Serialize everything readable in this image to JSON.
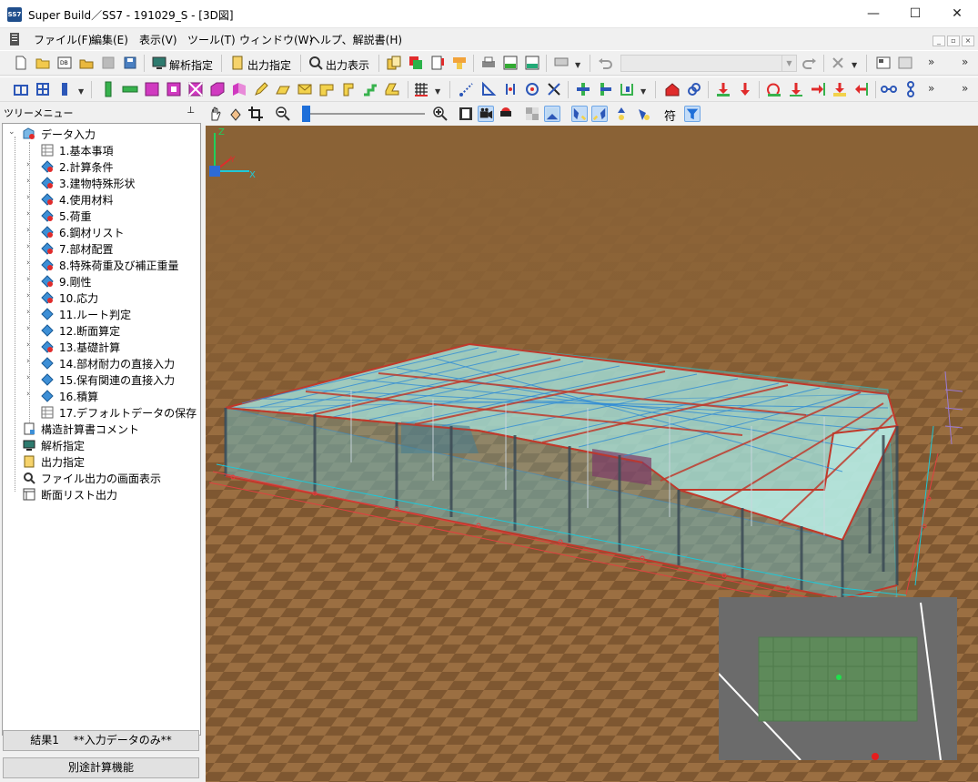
{
  "window": {
    "icon_text": "SS7",
    "title": "Super Build／SS7 - 191029_S - [3D図]",
    "minimize": "—",
    "maximize": "☐",
    "close": "✕"
  },
  "menu": {
    "items": [
      "ファイル(F)",
      "編集(E)",
      "表示(V)",
      "ツール(T)",
      "ウィンドウ(W)",
      "ヘルプ、解説書(H)"
    ]
  },
  "toolbar1": {
    "analysis_label": "解析指定",
    "output_label": "出力指定",
    "display_label": "出力表示",
    "combo_value": ""
  },
  "tree": {
    "header": "ツリーメニュー",
    "pin": "📌",
    "root": "データ入力",
    "items": [
      "1.基本事項",
      "2.計算条件",
      "3.建物特殊形状",
      "4.使用材料",
      "5.荷重",
      "6.鋼材リスト",
      "7.部材配置",
      "8.特殊荷重及び補正重量",
      "9.剛性",
      "10.応力",
      "11.ルート判定",
      "12.断面算定",
      "13.基礎計算",
      "14.部材耐力の直接入力",
      "15.保有関連の直接入力",
      "16.積算",
      "17.デフォルトデータの保存"
    ],
    "top_items": [
      "構造計算書コメント",
      "解析指定",
      "出力指定",
      "ファイル出力の画面表示",
      "断面リスト出力"
    ]
  },
  "status": {
    "result_label": "結果1　 **入力データのみ**",
    "separate_calc": "別途計算機能"
  },
  "view_toolbar": {
    "kanji_button": "符"
  },
  "axes": {
    "z": "Z",
    "y": "Y",
    "x": "X"
  },
  "colors": {
    "ground": "#8a6236",
    "slab": "#a8e6df",
    "beam_red": "#c0392b",
    "beam_blue": "#2e8bd6",
    "dim_red": "#e04040",
    "dim_cyan": "#1ec8d8"
  }
}
